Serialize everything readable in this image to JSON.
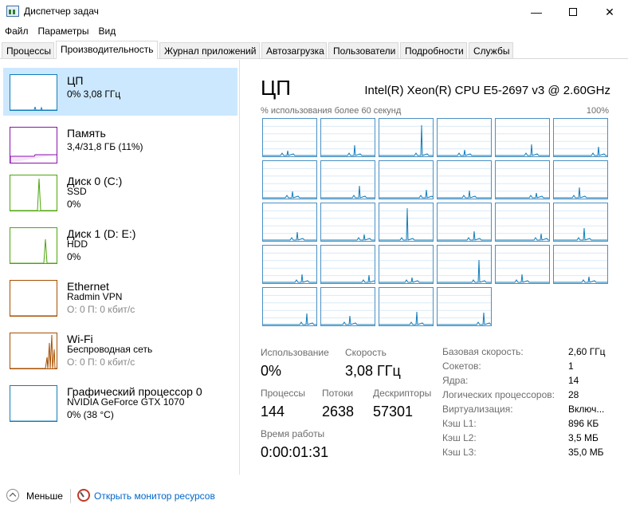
{
  "window": {
    "title": "Диспетчер задач"
  },
  "menu": [
    "Файл",
    "Параметры",
    "Вид"
  ],
  "tabs": [
    "Процессы",
    "Производительность",
    "Журнал приложений",
    "Автозагрузка",
    "Пользователи",
    "Подробности",
    "Службы"
  ],
  "active_tab": "Производительность",
  "sidebar": [
    {
      "title": "ЦП",
      "line1": "0% 3,08 ГГц",
      "line2": "",
      "color": "#117dbb",
      "icon": "cpu-graph"
    },
    {
      "title": "Память",
      "line1": "3,4/31,8 ГБ (11%)",
      "line2": "",
      "color": "#8b12ae",
      "icon": "memory-graph"
    },
    {
      "title": "Диск 0 (C:)",
      "line1": "SSD",
      "line2": "0%",
      "color": "#4da60c",
      "icon": "disk-graph"
    },
    {
      "title": "Диск 1 (D: E:)",
      "line1": "HDD",
      "line2": "0%",
      "color": "#4da60c",
      "icon": "disk-graph"
    },
    {
      "title": "Ethernet",
      "line1": "Radmin VPN",
      "line2": "О: 0 П: 0 кбит/с",
      "color": "#a74f01",
      "icon": "network-graph"
    },
    {
      "title": "Wi-Fi",
      "line1": "Беспроводная сеть",
      "line2": "О: 0 П: 0 кбит/с",
      "color": "#a74f01",
      "icon": "network-graph"
    },
    {
      "title": "Графический процессор 0",
      "line1": "NVIDIA GeForce GTX 1070",
      "line2": "0% (38 °C)",
      "color": "#117dbb",
      "icon": "gpu-graph"
    }
  ],
  "main": {
    "title": "ЦП",
    "cpu_model": "Intel(R) Xeon(R) CPU E5-2697 v3 @ 2.60GHz",
    "graph_caption": "% использования более 60 секунд",
    "graph_max": "100%",
    "core_count": 28,
    "stats": {
      "usage_label": "Использование",
      "usage_value": "0%",
      "speed_label": "Скорость",
      "speed_value": "3,08 ГГц",
      "processes_label": "Процессы",
      "processes_value": "144",
      "threads_label": "Потоки",
      "threads_value": "2638",
      "handles_label": "Дескрипторы",
      "handles_value": "57301",
      "uptime_label": "Время работы",
      "uptime_value": "0:00:01:31"
    },
    "info": [
      {
        "label": "Базовая скорость:",
        "value": "2,60 ГГц"
      },
      {
        "label": "Сокетов:",
        "value": "1"
      },
      {
        "label": "Ядра:",
        "value": "14"
      },
      {
        "label": "Логических процессоров:",
        "value": "28"
      },
      {
        "label": "Виртуализация:",
        "value": "Включ..."
      },
      {
        "label": "Кэш L1:",
        "value": "896 КБ"
      },
      {
        "label": "Кэш L2:",
        "value": "3,5 МБ"
      },
      {
        "label": "Кэш L3:",
        "value": "35,0 МБ"
      }
    ]
  },
  "footer": {
    "less_label": "Меньше",
    "monitor_label": "Открыть монитор ресурсов"
  },
  "colors": {
    "cpu": "#117dbb",
    "memory": "#8b12ae",
    "disk": "#4da60c",
    "network": "#a74f01",
    "selected": "#cce8ff",
    "link": "#0066cc"
  }
}
